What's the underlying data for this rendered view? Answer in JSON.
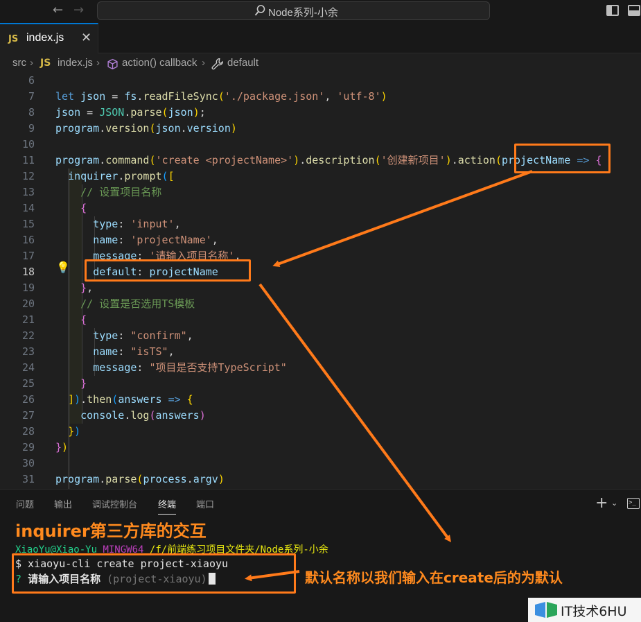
{
  "window": {
    "title": "Node系列-小余",
    "nav_back": "←",
    "nav_forward": "→"
  },
  "tabs": [
    {
      "badge": "JS",
      "label": "index.js",
      "close": "✕"
    }
  ],
  "breadcrumb": {
    "folder": "src",
    "file_badge": "JS",
    "file": "index.js",
    "symbol": "action() callback",
    "property": "default",
    "sep": "›"
  },
  "editor": {
    "active_line": "18",
    "line_numbers": [
      "6",
      "7",
      "8",
      "9",
      "10",
      "11",
      "12",
      "13",
      "14",
      "15",
      "16",
      "17",
      "18",
      "19",
      "20",
      "21",
      "22",
      "23",
      "24",
      "25",
      "26",
      "27",
      "28",
      "29",
      "30",
      "31"
    ],
    "lines": [
      [],
      [
        [
          "kw",
          "let "
        ],
        [
          "vr",
          "json"
        ],
        [
          "pn",
          " = "
        ],
        [
          "vr",
          "fs"
        ],
        [
          "pn",
          "."
        ],
        [
          "fn",
          "readFileSync"
        ],
        [
          "b1",
          "("
        ],
        [
          "st",
          "'./package.json'"
        ],
        [
          "pn",
          ", "
        ],
        [
          "st",
          "'utf-8'"
        ],
        [
          "b1",
          ")"
        ]
      ],
      [
        [
          "vr",
          "json"
        ],
        [
          "pn",
          " = "
        ],
        [
          "cls",
          "JSON"
        ],
        [
          "pn",
          "."
        ],
        [
          "fn",
          "parse"
        ],
        [
          "b1",
          "("
        ],
        [
          "vr",
          "json"
        ],
        [
          "b1",
          ")"
        ],
        [
          "pn",
          ";"
        ]
      ],
      [
        [
          "vr",
          "program"
        ],
        [
          "pn",
          "."
        ],
        [
          "fn",
          "version"
        ],
        [
          "b1",
          "("
        ],
        [
          "vr",
          "json"
        ],
        [
          "pn",
          "."
        ],
        [
          "vr",
          "version"
        ],
        [
          "b1",
          ")"
        ]
      ],
      [],
      [
        [
          "vr",
          "program"
        ],
        [
          "pn",
          "."
        ],
        [
          "fn",
          "command"
        ],
        [
          "b1",
          "("
        ],
        [
          "st",
          "'create <projectName>'"
        ],
        [
          "b1",
          ")"
        ],
        [
          "pn",
          "."
        ],
        [
          "fn",
          "description"
        ],
        [
          "b1",
          "("
        ],
        [
          "st",
          "'创建新项目'"
        ],
        [
          "b1",
          ")"
        ],
        [
          "pn",
          "."
        ],
        [
          "fn",
          "action"
        ],
        [
          "b1",
          "("
        ],
        [
          "vr",
          "projectName"
        ],
        [
          "pn",
          " "
        ],
        [
          "ar",
          "=>"
        ],
        [
          "pn",
          " "
        ],
        [
          "b2",
          "{"
        ]
      ],
      [
        [
          "pn",
          "  "
        ],
        [
          "vr",
          "inquirer"
        ],
        [
          "pn",
          "."
        ],
        [
          "fn",
          "prompt"
        ],
        [
          "b3",
          "("
        ],
        [
          "b1",
          "["
        ]
      ],
      [
        [
          "pn",
          "    "
        ],
        [
          "cm",
          "// 设置项目名称"
        ]
      ],
      [
        [
          "pn",
          "    "
        ],
        [
          "b2",
          "{"
        ]
      ],
      [
        [
          "pn",
          "      "
        ],
        [
          "vr",
          "type"
        ],
        [
          "pn",
          ": "
        ],
        [
          "st",
          "'input'"
        ],
        [
          "pn",
          ","
        ]
      ],
      [
        [
          "pn",
          "      "
        ],
        [
          "vr",
          "name"
        ],
        [
          "pn",
          ": "
        ],
        [
          "st",
          "'projectName'"
        ],
        [
          "pn",
          ","
        ]
      ],
      [
        [
          "pn",
          "      "
        ],
        [
          "vr",
          "message"
        ],
        [
          "pn",
          ": "
        ],
        [
          "st",
          "'请输入项目名称'"
        ],
        [
          "pn",
          ","
        ]
      ],
      [
        [
          "pn",
          "      "
        ],
        [
          "vr",
          "default"
        ],
        [
          "pn",
          ": "
        ],
        [
          "vr",
          "projectName"
        ]
      ],
      [
        [
          "pn",
          "    "
        ],
        [
          "b2",
          "}"
        ],
        [
          "pn",
          ","
        ]
      ],
      [
        [
          "pn",
          "    "
        ],
        [
          "cm",
          "// 设置是否选用TS模板"
        ]
      ],
      [
        [
          "pn",
          "    "
        ],
        [
          "b2",
          "{"
        ]
      ],
      [
        [
          "pn",
          "      "
        ],
        [
          "vr",
          "type"
        ],
        [
          "pn",
          ": "
        ],
        [
          "st",
          "\"confirm\""
        ],
        [
          "pn",
          ","
        ]
      ],
      [
        [
          "pn",
          "      "
        ],
        [
          "vr",
          "name"
        ],
        [
          "pn",
          ": "
        ],
        [
          "st",
          "\"isTS\""
        ],
        [
          "pn",
          ","
        ]
      ],
      [
        [
          "pn",
          "      "
        ],
        [
          "vr",
          "message"
        ],
        [
          "pn",
          ": "
        ],
        [
          "st",
          "\"项目是否支持TypeScript\""
        ]
      ],
      [
        [
          "pn",
          "    "
        ],
        [
          "b2",
          "}"
        ]
      ],
      [
        [
          "pn",
          "  "
        ],
        [
          "b1",
          "]"
        ],
        [
          "b3",
          ")"
        ],
        [
          "pn",
          "."
        ],
        [
          "fn",
          "then"
        ],
        [
          "b3",
          "("
        ],
        [
          "vr",
          "answers"
        ],
        [
          "pn",
          " "
        ],
        [
          "ar",
          "=>"
        ],
        [
          "pn",
          " "
        ],
        [
          "b1",
          "{"
        ]
      ],
      [
        [
          "pn",
          "    "
        ],
        [
          "vr",
          "console"
        ],
        [
          "pn",
          "."
        ],
        [
          "fn",
          "log"
        ],
        [
          "b2",
          "("
        ],
        [
          "vr",
          "answers"
        ],
        [
          "b2",
          ")"
        ]
      ],
      [
        [
          "pn",
          "  "
        ],
        [
          "b1",
          "}"
        ],
        [
          "b3",
          ")"
        ]
      ],
      [
        [
          "b2",
          "}"
        ],
        [
          "b1",
          ")"
        ]
      ],
      [],
      [
        [
          "vr",
          "program"
        ],
        [
          "pn",
          "."
        ],
        [
          "fn",
          "parse"
        ],
        [
          "b1",
          "("
        ],
        [
          "vr",
          "process"
        ],
        [
          "pn",
          "."
        ],
        [
          "vr",
          "argv"
        ],
        [
          "b1",
          ")"
        ]
      ]
    ]
  },
  "panel": {
    "tabs": [
      "问题",
      "输出",
      "调试控制台",
      "终端",
      "端口"
    ],
    "active_tab": "终端",
    "add_label": "+",
    "chevron": "⌄",
    "terminal_icon_label": ">_"
  },
  "terminal": {
    "user": "XiaoYu@Xiao-Yu",
    "host": "MINGW64",
    "path": "/f/前端练习项目文件夹/Node系列-小余",
    "command": "$ xiaoyu-cli create project-xiaoyu",
    "question_mark": "?",
    "question": "请输入项目名称",
    "default_hint": "(project-xiaoyu)"
  },
  "annotations": {
    "heading": "inquirer第三方库的交互",
    "arrow_note": "默认名称以我们输入在create后的为默认",
    "color": "#ff7a1a"
  },
  "watermark": {
    "text": "IT技术6HU"
  }
}
